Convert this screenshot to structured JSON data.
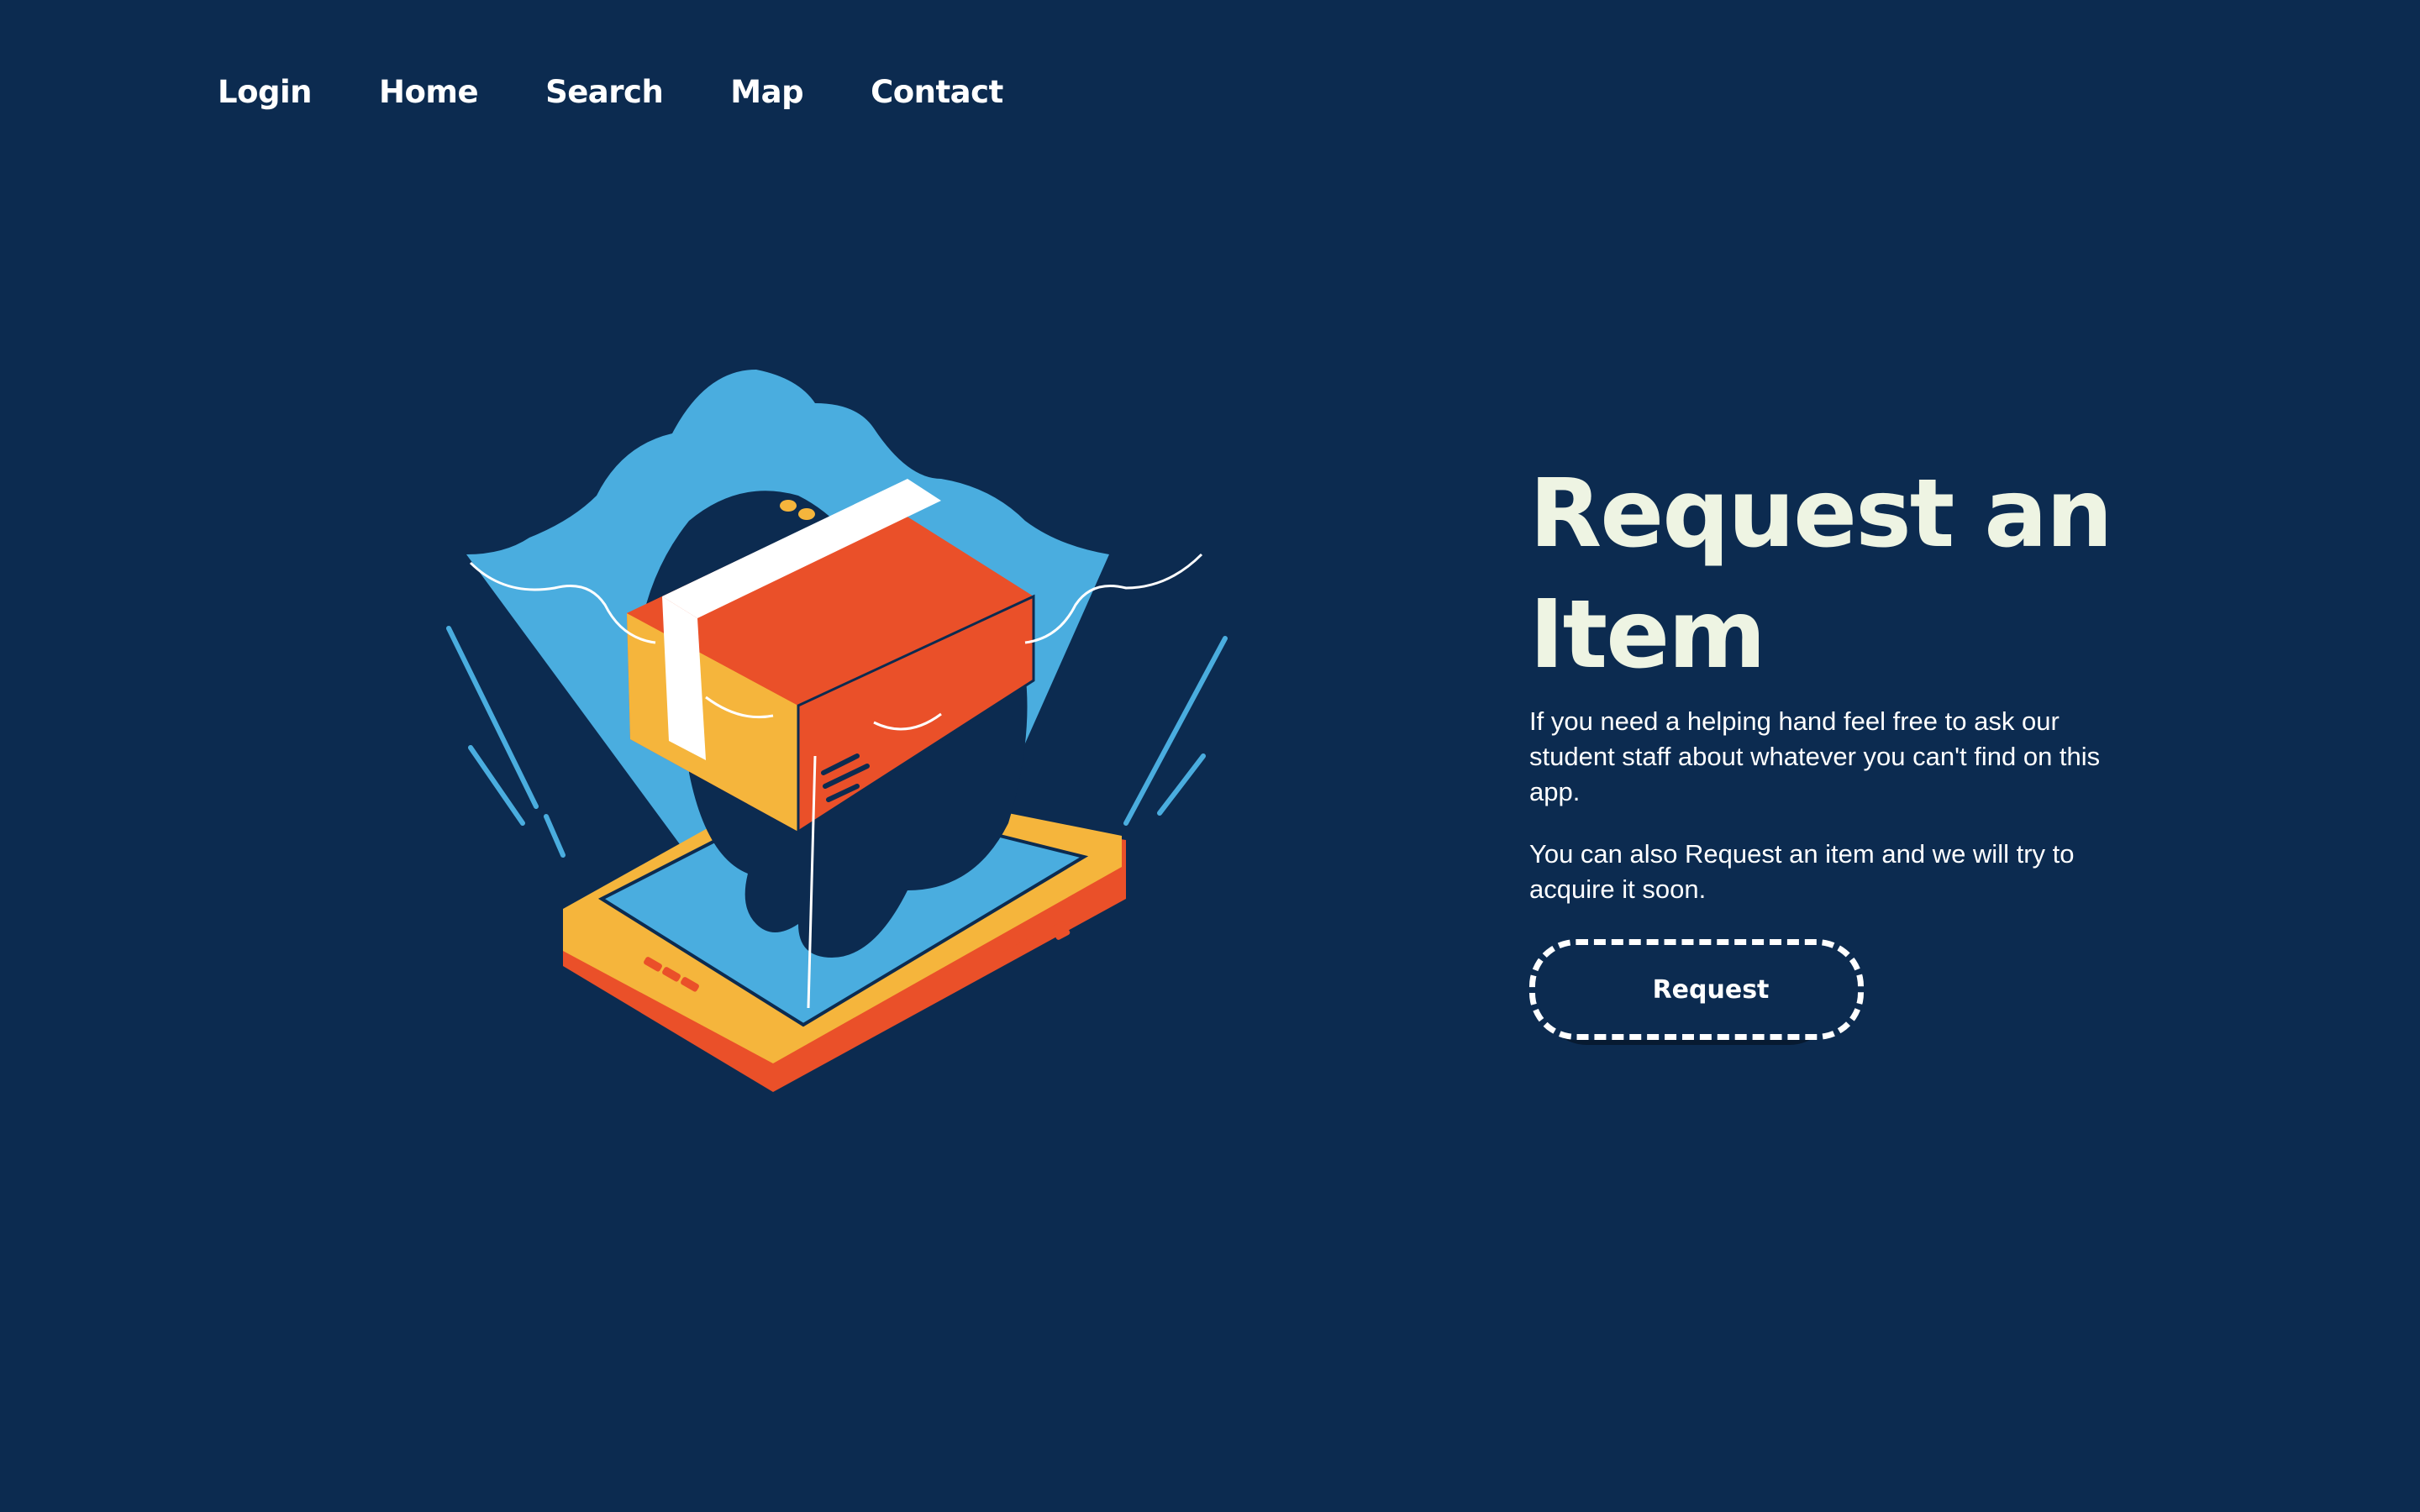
{
  "nav": {
    "items": [
      {
        "label": "Login"
      },
      {
        "label": "Home"
      },
      {
        "label": "Search"
      },
      {
        "label": "Map"
      },
      {
        "label": "Contact"
      }
    ]
  },
  "hero": {
    "title": "Request an Item",
    "paragraph1": "If you need a helping hand feel free to ask our student staff about whatever you can't find on this app.",
    "paragraph2": "You can also Request an item and we will try to acquire it soon.",
    "button_label": "Request"
  },
  "colors": {
    "background": "#0c2b50",
    "title": "#eef4e3",
    "illustration_blue": "#4aaddf",
    "box_orange": "#ea5029",
    "box_yellow": "#f5b53c"
  },
  "icons": {
    "illustration": "hand-holding-package-over-phone-illustration"
  }
}
